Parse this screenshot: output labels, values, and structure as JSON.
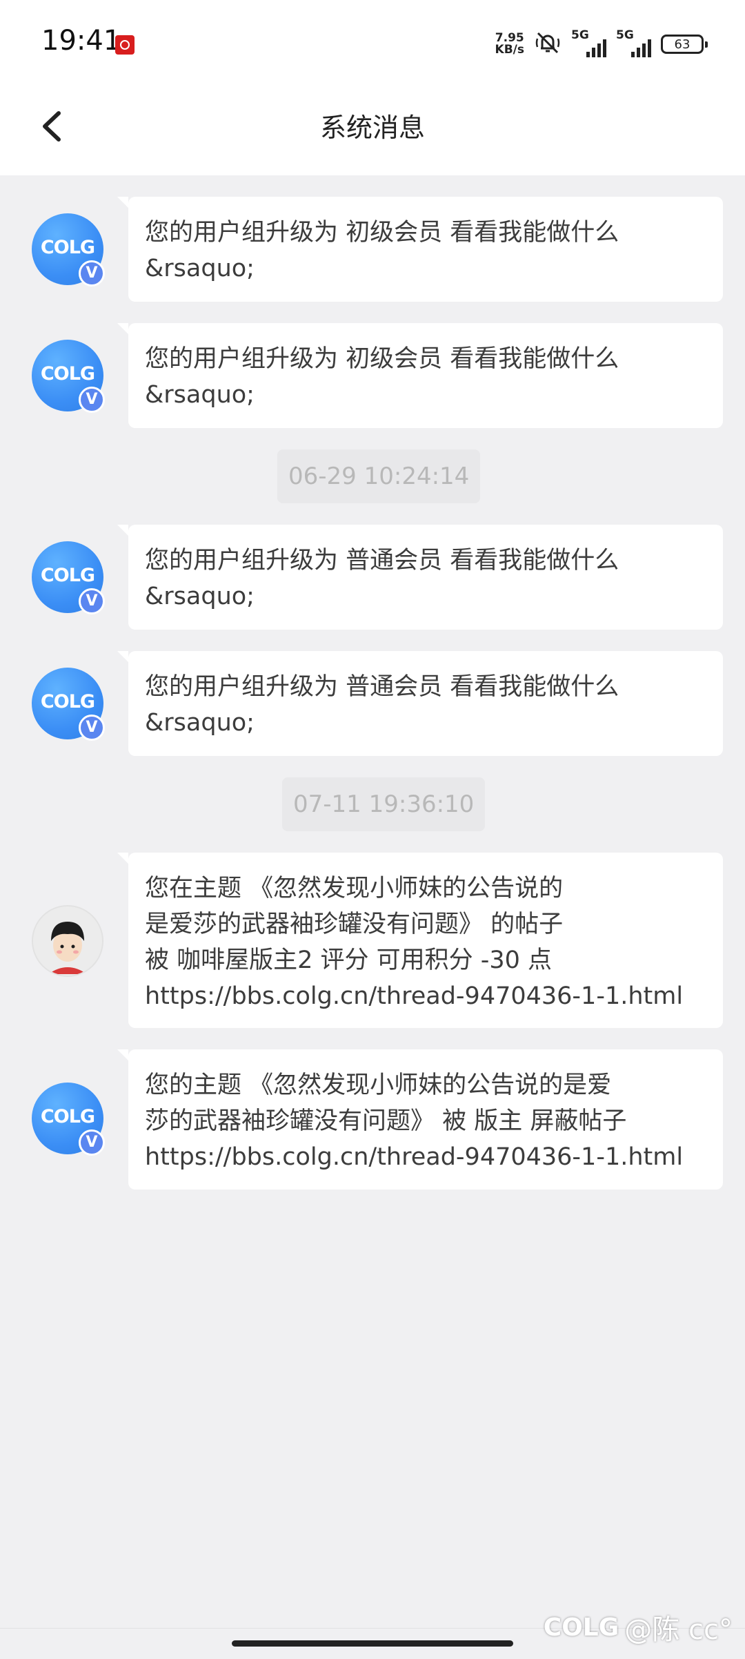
{
  "status_bar": {
    "time": "19:41",
    "net_speed_value": "7.95",
    "net_speed_unit": "KB/s",
    "signal1_label": "5G",
    "signal2_label": "5G",
    "battery": "63"
  },
  "header": {
    "title": "系统消息"
  },
  "messages": [
    {
      "avatar": "colg",
      "avatar_text": "COLG",
      "badge": "V",
      "text": "您的用户组升级为 初级会员  看看我能做什么\n&rsaquo;"
    },
    {
      "avatar": "colg",
      "avatar_text": "COLG",
      "badge": "V",
      "text": "您的用户组升级为 初级会员  看看我能做什么\n&rsaquo;"
    },
    {
      "timestamp": "06-29 10:24:14"
    },
    {
      "avatar": "colg",
      "avatar_text": "COLG",
      "badge": "V",
      "text": "您的用户组升级为 普通会员  看看我能做什么\n&rsaquo;"
    },
    {
      "avatar": "colg",
      "avatar_text": "COLG",
      "badge": "V",
      "text": "您的用户组升级为 普通会员  看看我能做什么\n&rsaquo;"
    },
    {
      "timestamp": "07-11 19:36:10"
    },
    {
      "avatar": "user",
      "text": "您在主题 《忽然发现小师妹的公告说的\n是爱莎的武器袖珍罐没有问题》 的帖子\n被 咖啡屋版主2 评分 可用积分 -30 点\nhttps://bbs.colg.cn/thread-9470436-1-1.html"
    },
    {
      "avatar": "colg",
      "avatar_text": "COLG",
      "badge": "V",
      "text": "您的主题 《忽然发现小师妹的公告说的是爱\n莎的武器袖珍罐没有问题》 被 版主 屏蔽帖子\nhttps://bbs.colg.cn/thread-9470436-1-1.html"
    }
  ],
  "watermark": {
    "logo": "COLG",
    "text": "@陈 cc°"
  }
}
